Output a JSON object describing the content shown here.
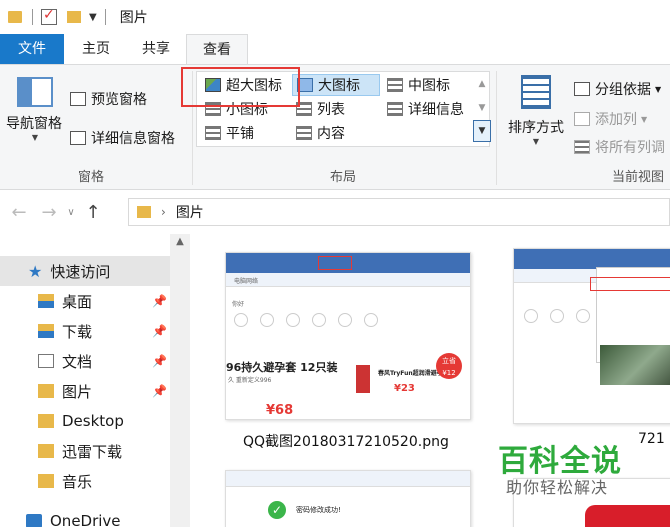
{
  "titlebar": {
    "title": "图片"
  },
  "tabs": [
    {
      "label": "文件"
    },
    {
      "label": "主页"
    },
    {
      "label": "共享"
    },
    {
      "label": "查看"
    }
  ],
  "ribbon": {
    "panes_group": {
      "label": "窗格",
      "nav_pane": "导航窗格",
      "preview_pane": "预览窗格",
      "details_pane": "详细信息窗格"
    },
    "layout_group": {
      "label": "布局",
      "items": [
        "超大图标",
        "大图标",
        "中图标",
        "小图标",
        "列表",
        "详细信息",
        "平铺",
        "内容"
      ],
      "selected": "大图标"
    },
    "sort_group": {
      "sort_by": "排序方式",
      "group_by": "分组依据",
      "add_column": "添加列",
      "fit_columns": "将所有列调",
      "label": "当前视图"
    }
  },
  "address": {
    "path": "图片"
  },
  "navpane": {
    "items": [
      {
        "label": "快速访问",
        "pinned": false
      },
      {
        "label": "桌面",
        "pinned": true
      },
      {
        "label": "下载",
        "pinned": true
      },
      {
        "label": "文档",
        "pinned": true
      },
      {
        "label": "图片",
        "pinned": true
      },
      {
        "label": "Desktop",
        "pinned": false
      },
      {
        "label": "迅雷下载",
        "pinned": false
      },
      {
        "label": "音乐",
        "pinned": false
      },
      {
        "label": "OneDrive",
        "pinned": false
      }
    ]
  },
  "files": [
    {
      "name": "QQ截图20180317210520.png",
      "thumb_text": {
        "brand": "电脑网络",
        "heading": "96持久避孕套 12只装",
        "sub": "久 重新定义996",
        "price": "¥68",
        "price2": "¥23",
        "greeting": "你好",
        "badge": "立省 ¥12",
        "promo": "春风TryFun超润滑避孕套"
      }
    },
    {
      "name": "721"
    },
    {
      "name": "",
      "thumb_text": {
        "message": "密码修改成功!"
      }
    }
  ],
  "watermark": {
    "line1": "百科全说",
    "line2": "助你轻松解决"
  }
}
